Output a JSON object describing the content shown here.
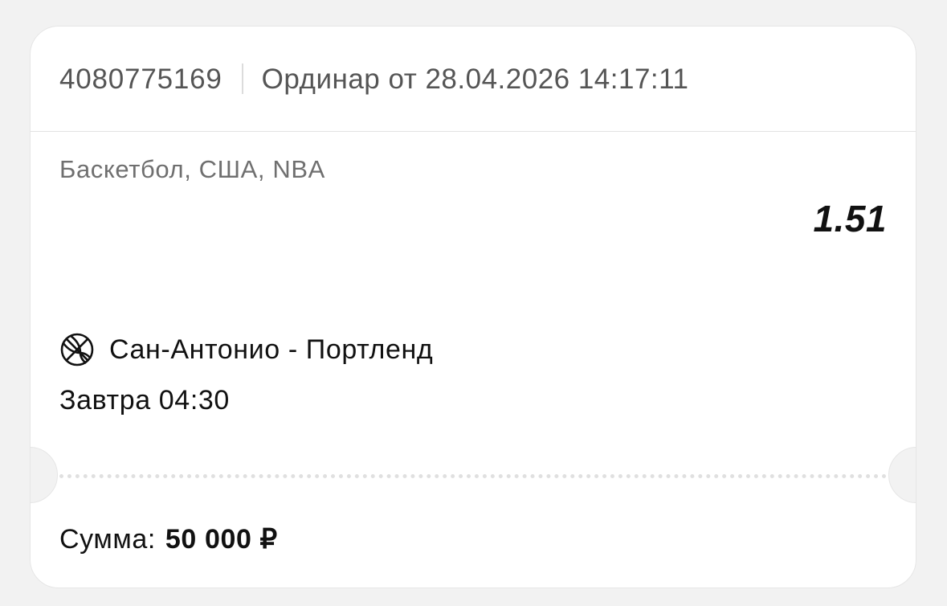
{
  "bet": {
    "id": "4080775169",
    "type_line": "Ординар от 28.04.2026 14:17:11"
  },
  "event": {
    "sport_line": "Баскетбол, США, NBA",
    "odds": "1.51",
    "icon": "basketball-icon",
    "match": "Сан-Антонио - Портленд",
    "time": "Завтра 04:30"
  },
  "summary": {
    "label": "Сумма:",
    "value": "50 000 ₽"
  }
}
